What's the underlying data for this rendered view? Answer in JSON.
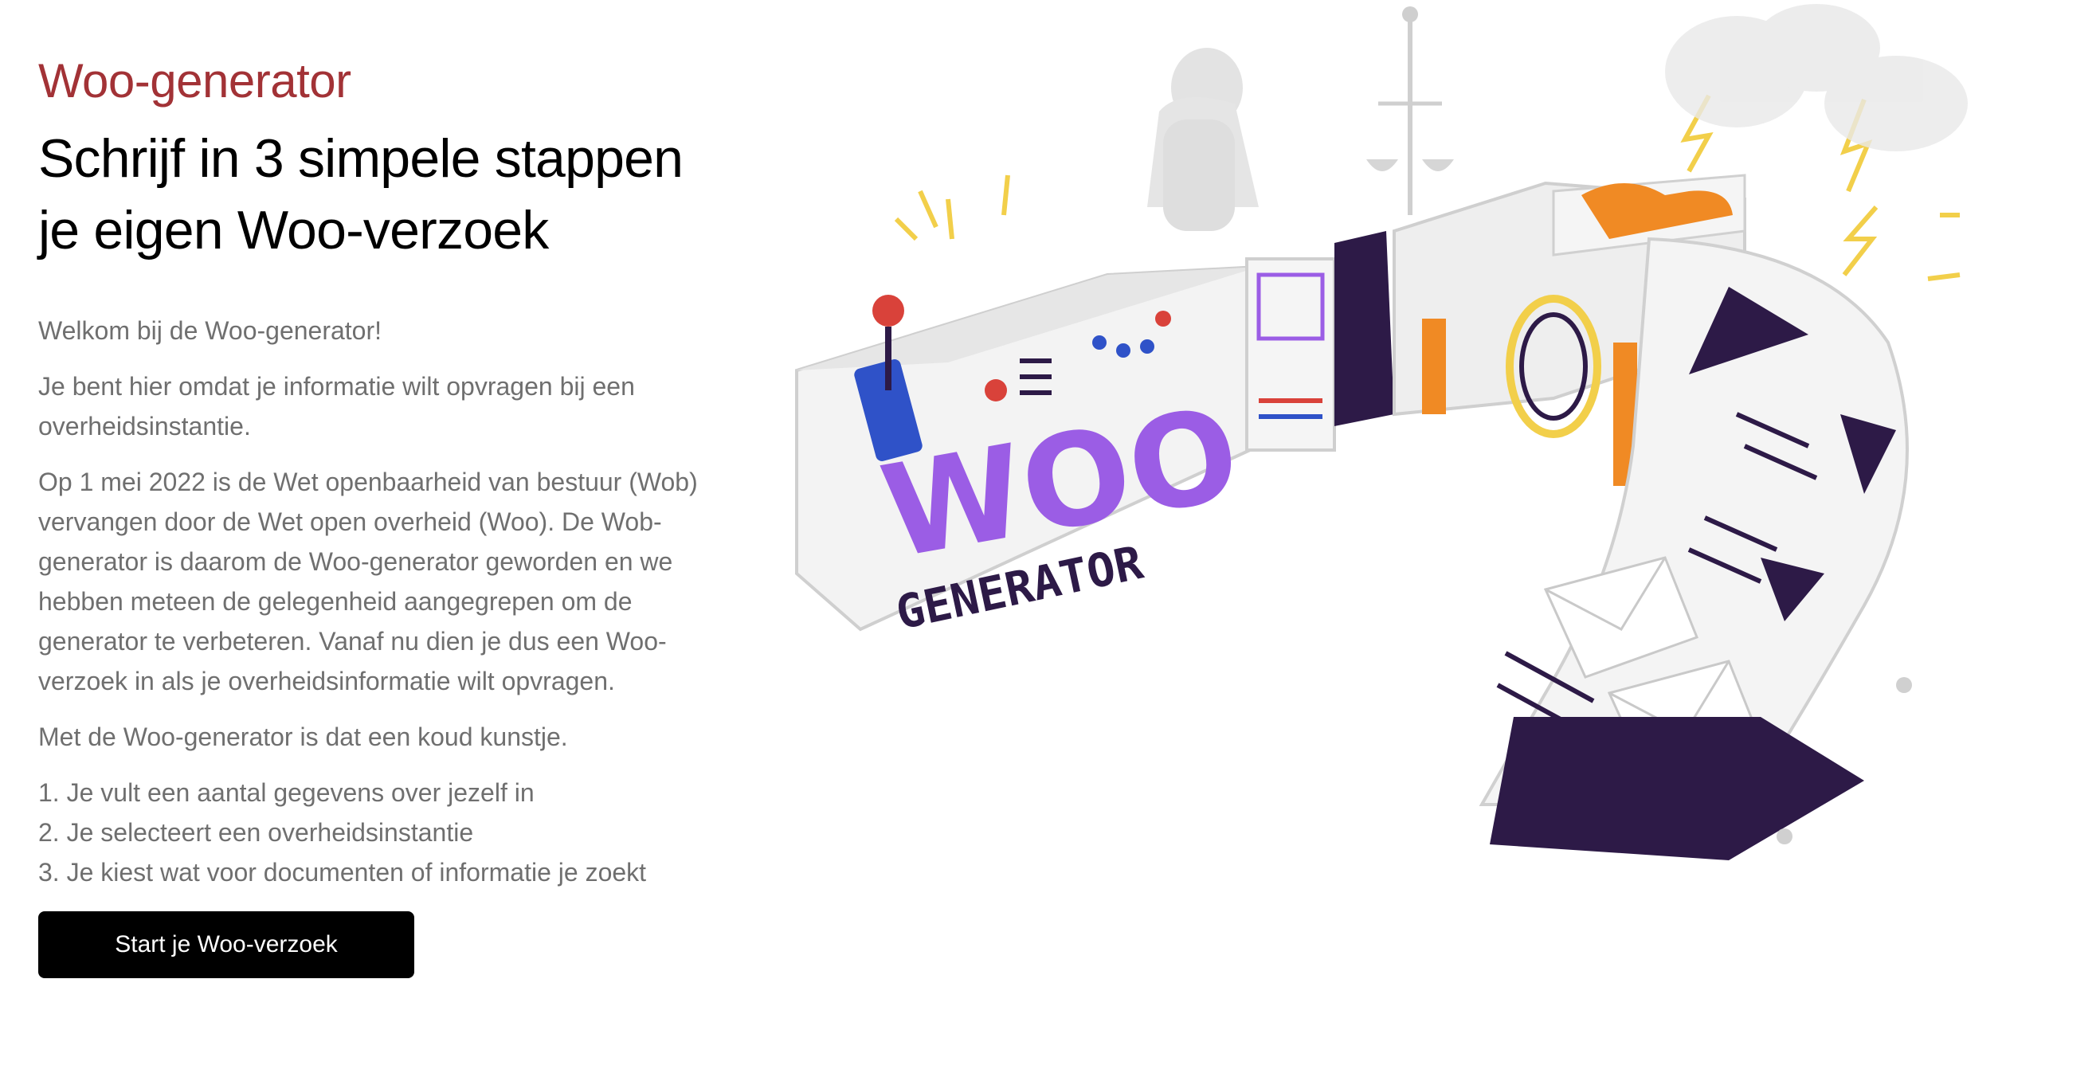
{
  "brand": "Woo-generator",
  "headline": {
    "line1": "Schrijf in 3 simpele stappen",
    "line2": "je eigen Woo-verzoek"
  },
  "intro": {
    "p1": "Welkom bij de Woo-generator!",
    "p2": "Je bent hier omdat je informatie wilt opvragen bij een overheidsinstantie.",
    "p3": "Op 1 mei 2022 is de Wet openbaarheid van bestuur (Wob) vervangen door de Wet open overheid (Woo). De Wob-generator is daarom de Woo-generator geworden en we hebben meteen de gelegenheid aangegrepen om de generator te verbeteren. Vanaf nu dien je dus een Woo-verzoek in als je overheidsinformatie wilt opvragen.",
    "p4": "Met de Woo-generator is dat een koud kunstje."
  },
  "steps": [
    "1. Je vult een aantal gegevens over jezelf in",
    "2. Je selecteert een overheidsinstantie",
    "3. Je kiest wat voor documenten of informatie je zoekt"
  ],
  "cta": {
    "label": "Start je Woo-verzoek"
  },
  "illustration": {
    "logo_line1": "WOO",
    "logo_line2": "GENERATOR"
  },
  "colors": {
    "brand": "#a23236",
    "text_muted": "#6f6f6f",
    "button_bg": "#000000",
    "purple": "#9b5de5",
    "dark_purple": "#2d1a47",
    "orange": "#f08a24",
    "yellow": "#f2cf4a",
    "red": "#d9423a",
    "blue": "#2f52c8"
  }
}
